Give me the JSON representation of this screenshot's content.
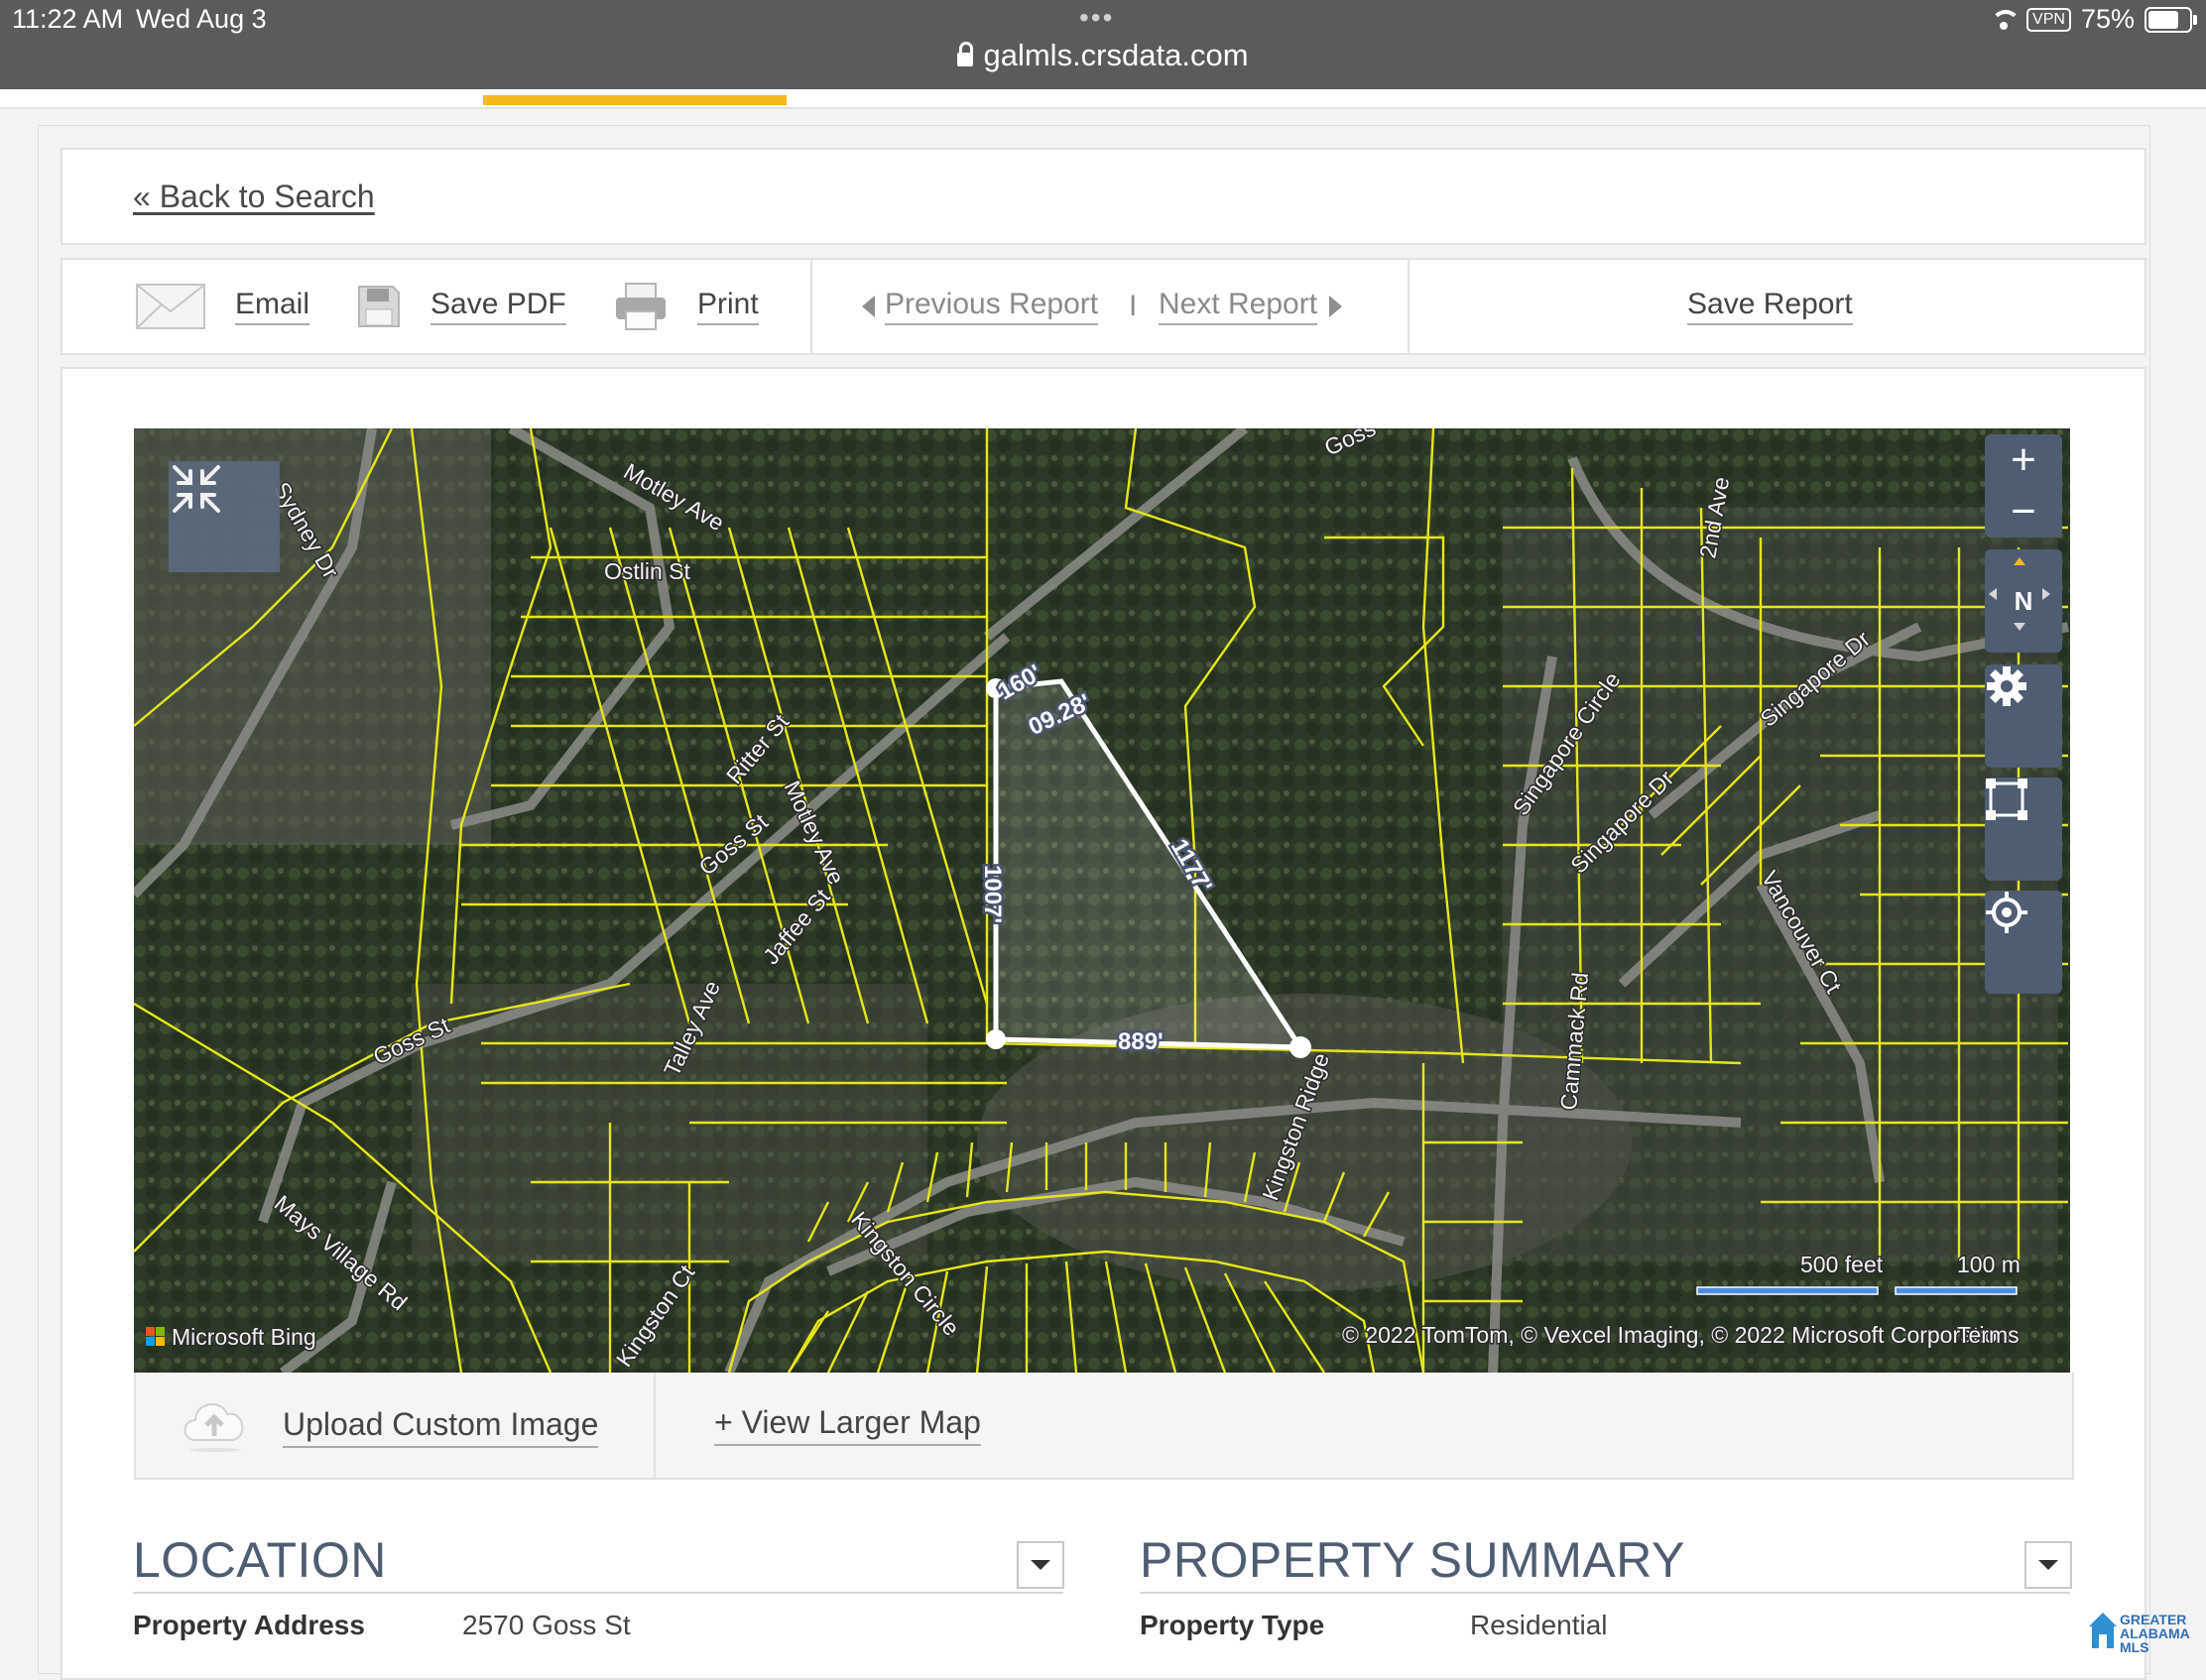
{
  "status_bar": {
    "time": "11:22 AM",
    "date": "Wed Aug 3",
    "url": "galmls.crsdata.com",
    "vpn": "VPN",
    "battery": "75%",
    "battery_level": 0.75
  },
  "nav": {
    "back_to_search": "« Back to Search"
  },
  "toolbar": {
    "email": "Email",
    "save_pdf": "Save PDF",
    "print": "Print",
    "previous_report": "Previous Report",
    "separator": "I",
    "next_report": "Next Report",
    "save_report": "Save Report"
  },
  "map": {
    "streets": [
      "Goss",
      "Motley Ave",
      "Ostlin St",
      "Sydney Dr",
      "Ritter St",
      "Goss St",
      "Motley Ave",
      "Jaffee St",
      "Talley Ave",
      "Goss St",
      "Mays Village Rd",
      "Kingston Ct",
      "Kingston Circle",
      "Kingston Ridge",
      "Singapore Circle",
      "Singapore Dr",
      "Singapore Dr",
      "Vancouver Ct",
      "Cammack Rd",
      "2nd Ave"
    ],
    "measurements": {
      "top": "160'",
      "diag_short": "09.28'",
      "left": "1007'",
      "diag_long": "1177'",
      "bottom": "889'"
    },
    "scale_feet": "500 feet",
    "scale_meters": "100 m",
    "attribution": "© 2022 TomTom, © Vexcel Imaging, © 2022 Microsoft Corporation",
    "terms": "Terms",
    "provider": "Microsoft Bing",
    "controls": {
      "zoom_in": "+",
      "zoom_out": "−",
      "north": "N"
    }
  },
  "map_actions": {
    "upload": "Upload Custom Image",
    "view_larger": "+ View Larger Map"
  },
  "location": {
    "title": "LOCATION",
    "label": "Property Address",
    "value": "2570 Goss St"
  },
  "summary": {
    "title": "PROPERTY SUMMARY",
    "label": "Property Type",
    "value": "Residential"
  },
  "logo": {
    "line1": "GREATER",
    "line2": "ALABAMA",
    "line3": "MLS"
  },
  "colors": {
    "accent": "#f5b91c",
    "section_title": "#4e5d72",
    "parcel_lines": "#e8e619",
    "map_control": "#4e5d72"
  }
}
